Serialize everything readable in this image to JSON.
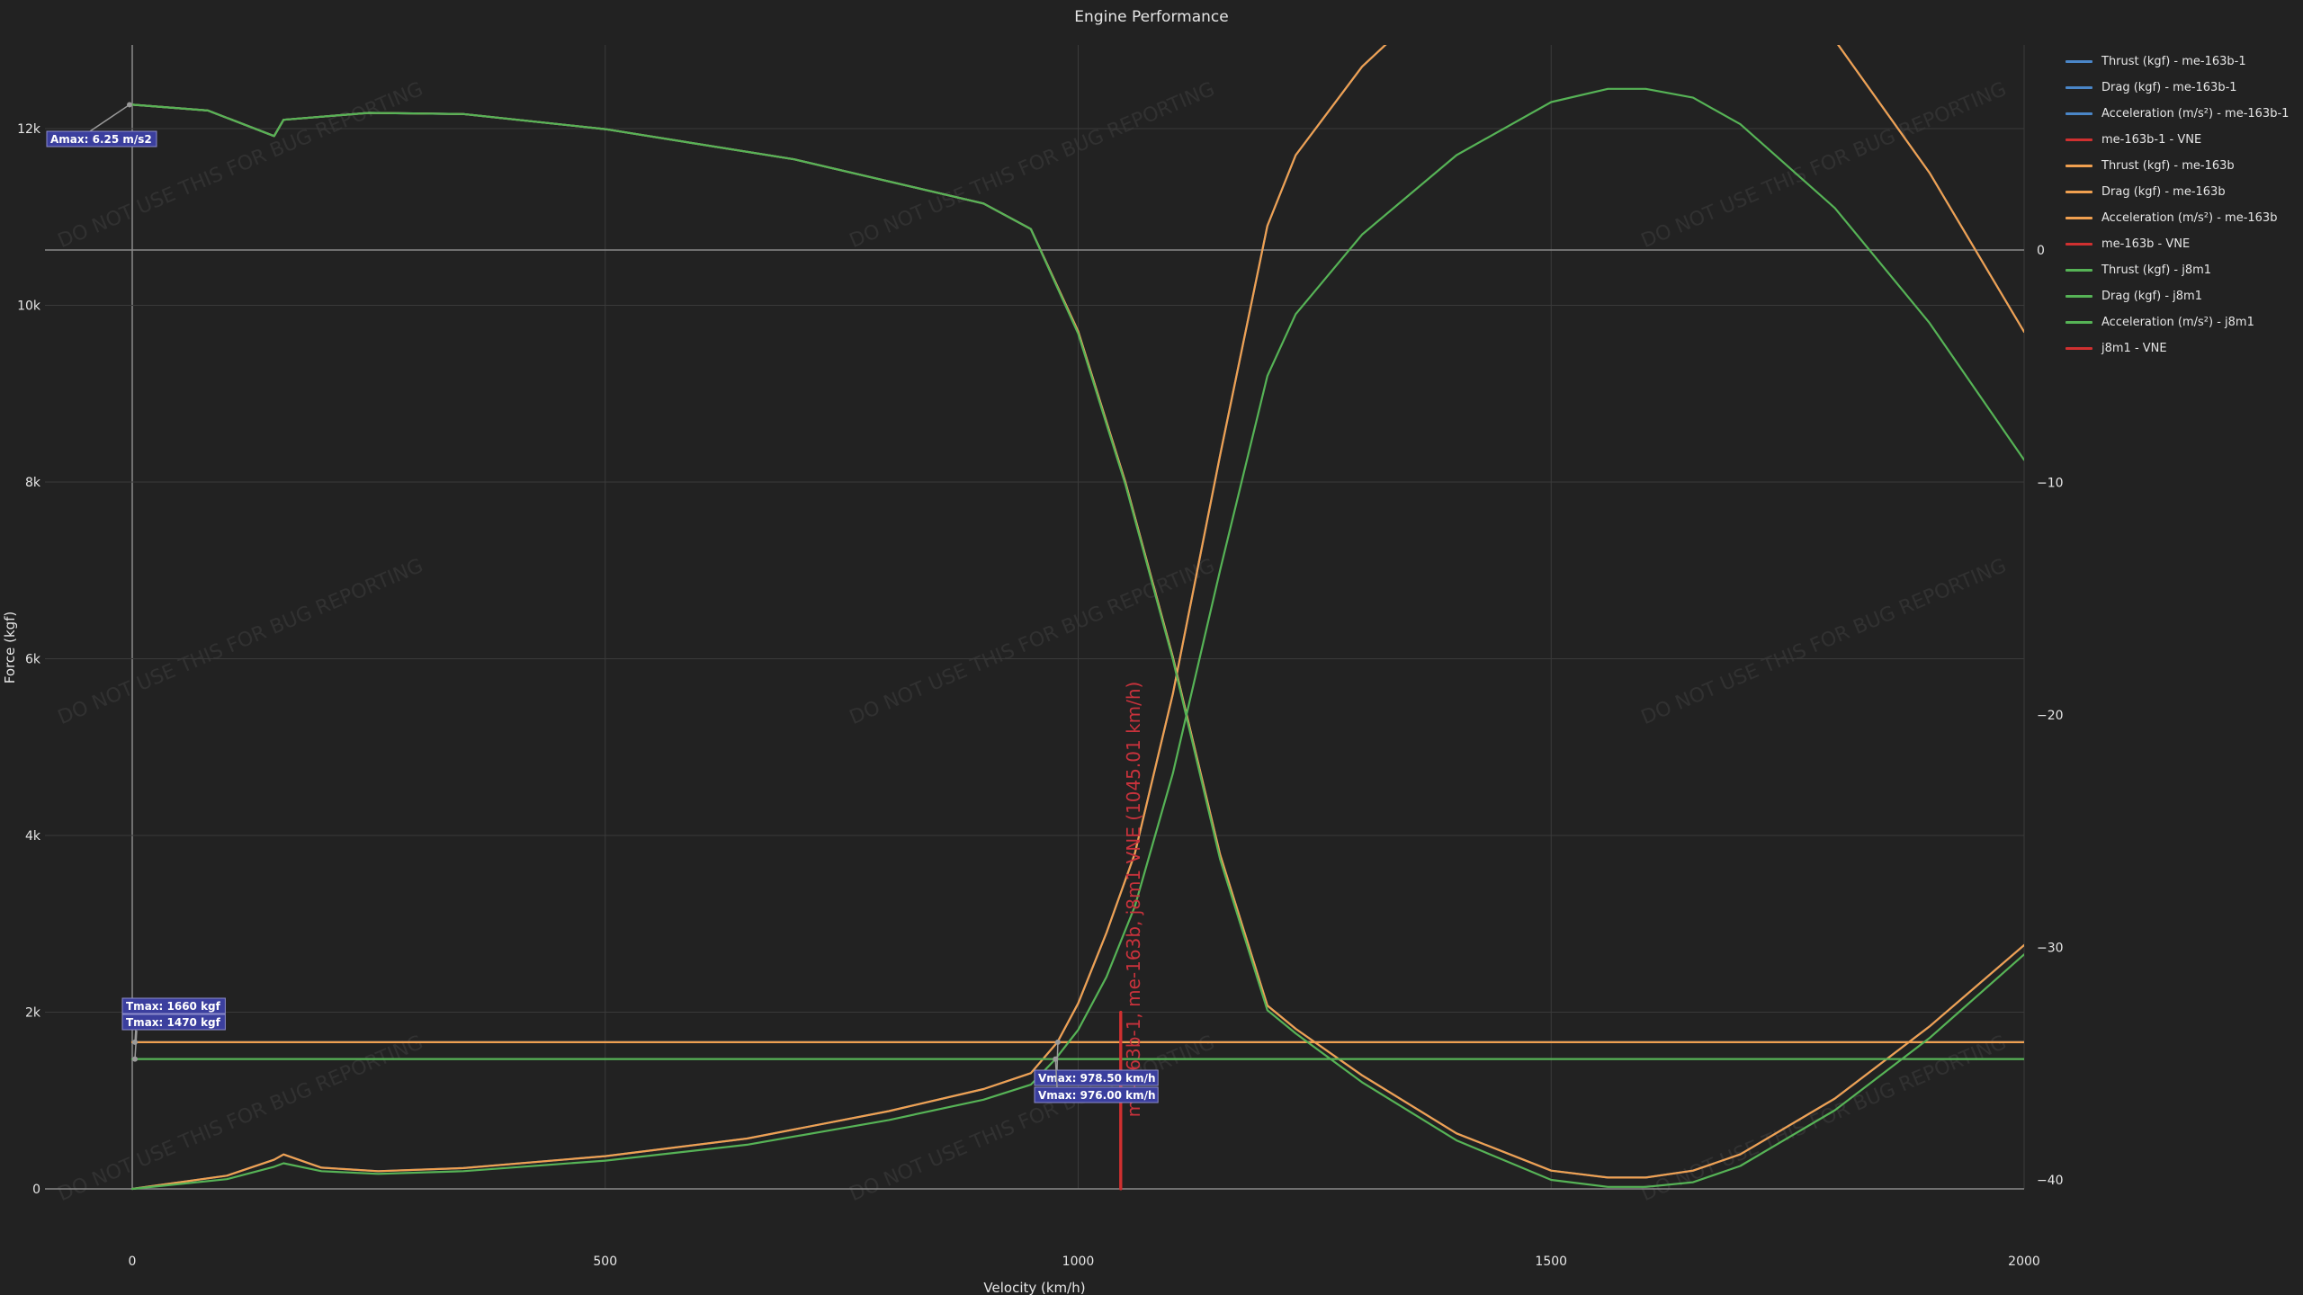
{
  "chart_data": {
    "type": "line",
    "title": "Engine Performance",
    "xlabel": "Velocity (km/h)",
    "ylabel": "Force (kgf)",
    "xlim": [
      -110,
      2000
    ],
    "ylim": [
      0,
      12800
    ],
    "y2lim": [
      -41.1,
      15.9
    ],
    "x_ticks": [
      0,
      500,
      1000,
      1500,
      2000
    ],
    "x_tick_labels": [
      "0",
      "500",
      "1000",
      "1500",
      "2000"
    ],
    "y_ticks": [
      0,
      2000,
      4000,
      6000,
      8000,
      10000,
      12000
    ],
    "y_tick_labels": [
      "0",
      "2k",
      "4k",
      "6k",
      "8k",
      "10k",
      "12k"
    ],
    "y2_ticks": [
      0,
      -10,
      -20,
      -30,
      -40
    ],
    "y2_tick_labels": [
      "0",
      "−10",
      "−20",
      "−30",
      "−40"
    ],
    "grid": true,
    "legend_position": "right",
    "watermark": "DO NOT USE THIS FOR BUG REPORTING",
    "series": [
      {
        "name": "Thrust (kgf) - me-163b-1",
        "color": "#4a86c8",
        "axis": "y",
        "x": [
          0,
          2000
        ],
        "y": [
          1660,
          1660
        ]
      },
      {
        "name": "Drag (kgf) - me-163b-1",
        "color": "#4a86c8",
        "axis": "y",
        "x": [
          0,
          100,
          150,
          160,
          200,
          260,
          350,
          500,
          650,
          800,
          900,
          950,
          978,
          1000,
          1030,
          1060,
          1100,
          1150,
          1200,
          1230,
          1300,
          1400,
          1500,
          1560,
          1600,
          1650,
          1700,
          1800,
          1900,
          2000
        ],
        "y": [
          0,
          150,
          330,
          390,
          240,
          200,
          235,
          370,
          570,
          880,
          1130,
          1310,
          1660,
          2100,
          2900,
          3800,
          5600,
          8300,
          10900,
          11700,
          12700,
          13700,
          14400,
          14600,
          14600,
          14450,
          14100,
          13000,
          11500,
          9700
        ]
      },
      {
        "name": "Acceleration (m/s²) - me-163b-1",
        "color": "#4a86c8",
        "axis": "y2",
        "x": [
          0,
          80,
          150,
          160,
          250,
          350,
          500,
          700,
          900,
          950,
          1000,
          1050,
          1100,
          1150,
          1200,
          1230,
          1300,
          1400,
          1500,
          1560,
          1600,
          1650,
          1700,
          1800,
          1900,
          2000
        ],
        "y": [
          6.25,
          6.0,
          4.9,
          5.6,
          5.9,
          5.85,
          5.2,
          3.9,
          2.0,
          0.9,
          -3.5,
          -10.0,
          -17.5,
          -26.0,
          -32.5,
          -33.5,
          -35.5,
          -38.0,
          -39.6,
          -39.9,
          -39.9,
          -39.6,
          -38.9,
          -36.5,
          -33.4,
          -29.9
        ]
      },
      {
        "name": "me-163b-1 - VNE",
        "color": "#d03030",
        "axis": "y",
        "x": [
          1045.01,
          1045.01
        ],
        "y": [
          0,
          2000
        ]
      },
      {
        "name": "Thrust (kgf) - me-163b",
        "color": "#f0a050",
        "axis": "y",
        "x": [
          0,
          2000
        ],
        "y": [
          1660,
          1660
        ]
      },
      {
        "name": "Drag (kgf) - me-163b",
        "color": "#f0a050",
        "axis": "y",
        "x": [
          0,
          100,
          150,
          160,
          200,
          260,
          350,
          500,
          650,
          800,
          900,
          950,
          978,
          1000,
          1030,
          1060,
          1100,
          1150,
          1200,
          1230,
          1300,
          1400,
          1500,
          1560,
          1600,
          1650,
          1700,
          1800,
          1900,
          2000
        ],
        "y": [
          0,
          150,
          330,
          390,
          240,
          200,
          235,
          370,
          570,
          880,
          1130,
          1310,
          1660,
          2100,
          2900,
          3800,
          5600,
          8300,
          10900,
          11700,
          12700,
          13700,
          14400,
          14600,
          14600,
          14450,
          14100,
          13000,
          11500,
          9700
        ]
      },
      {
        "name": "Acceleration (m/s²) - me-163b",
        "color": "#f0a050",
        "axis": "y2",
        "x": [
          0,
          80,
          150,
          160,
          250,
          350,
          500,
          700,
          900,
          950,
          1000,
          1050,
          1100,
          1150,
          1200,
          1230,
          1300,
          1400,
          1500,
          1560,
          1600,
          1650,
          1700,
          1800,
          1900,
          2000
        ],
        "y": [
          6.25,
          6.0,
          4.9,
          5.6,
          5.9,
          5.85,
          5.2,
          3.9,
          2.0,
          0.9,
          -3.5,
          -10.0,
          -17.5,
          -26.0,
          -32.5,
          -33.5,
          -35.5,
          -38.0,
          -39.6,
          -39.9,
          -39.9,
          -39.6,
          -38.9,
          -36.5,
          -33.4,
          -29.9
        ]
      },
      {
        "name": "me-163b - VNE",
        "color": "#d03030",
        "axis": "y",
        "x": [
          1045.01,
          1045.01
        ],
        "y": [
          0,
          2000
        ]
      },
      {
        "name": "Thrust (kgf) - j8m1",
        "color": "#56b356",
        "axis": "y",
        "x": [
          0,
          2000
        ],
        "y": [
          1470,
          1470
        ]
      },
      {
        "name": "Drag (kgf) - j8m1",
        "color": "#56b356",
        "axis": "y",
        "x": [
          0,
          100,
          150,
          160,
          200,
          260,
          350,
          500,
          650,
          800,
          900,
          950,
          976,
          1000,
          1030,
          1060,
          1100,
          1150,
          1200,
          1230,
          1300,
          1400,
          1500,
          1560,
          1600,
          1650,
          1700,
          1800,
          1900,
          2000
        ],
        "y": [
          0,
          110,
          250,
          290,
          200,
          170,
          200,
          320,
          500,
          780,
          1010,
          1180,
          1470,
          1800,
          2400,
          3200,
          4700,
          7000,
          9200,
          9900,
          10800,
          11700,
          12300,
          12450,
          12450,
          12350,
          12050,
          11100,
          9800,
          8250
        ]
      },
      {
        "name": "Acceleration (m/s²) - j8m1",
        "color": "#56b356",
        "axis": "y2",
        "x": [
          0,
          80,
          150,
          160,
          250,
          350,
          500,
          700,
          900,
          950,
          1000,
          1050,
          1100,
          1150,
          1200,
          1230,
          1300,
          1400,
          1500,
          1560,
          1600,
          1650,
          1700,
          1800,
          1900,
          2000
        ],
        "y": [
          6.25,
          6.0,
          4.9,
          5.6,
          5.9,
          5.85,
          5.2,
          3.9,
          2.0,
          0.9,
          -3.6,
          -10.1,
          -17.6,
          -26.2,
          -32.7,
          -33.7,
          -35.8,
          -38.3,
          -40.0,
          -40.3,
          -40.3,
          -40.1,
          -39.4,
          -37.0,
          -33.9,
          -30.3
        ]
      },
      {
        "name": "j8m1 - VNE",
        "color": "#d03030",
        "axis": "y",
        "x": [
          1045.01,
          1045.01
        ],
        "y": [
          0,
          2000
        ]
      }
    ],
    "annotations": [
      {
        "text": "Amax: 6.25 m/s2",
        "x": 0,
        "y": 6.25,
        "axis": "y2",
        "corner": "left"
      },
      {
        "text": "Tmax: 1660 kgf",
        "x": 0,
        "y": 1660,
        "axis": "y",
        "corner": "right-top"
      },
      {
        "text": "Tmax: 1470 kgf",
        "x": 0,
        "y": 1470,
        "axis": "y",
        "corner": "right-bottom"
      },
      {
        "text": "Vmax: 978.50 km/h",
        "x": 978.5,
        "y": 1660,
        "axis": "y",
        "corner": "right-top"
      },
      {
        "text": "Vmax: 976.00 km/h",
        "x": 976.0,
        "y": 1470,
        "axis": "y",
        "corner": "right-bottom"
      }
    ],
    "vne_label": "me-163b-1, me-163b, j8m1 VNE (1045.01 km/h)",
    "vne_x": 1045.01
  }
}
